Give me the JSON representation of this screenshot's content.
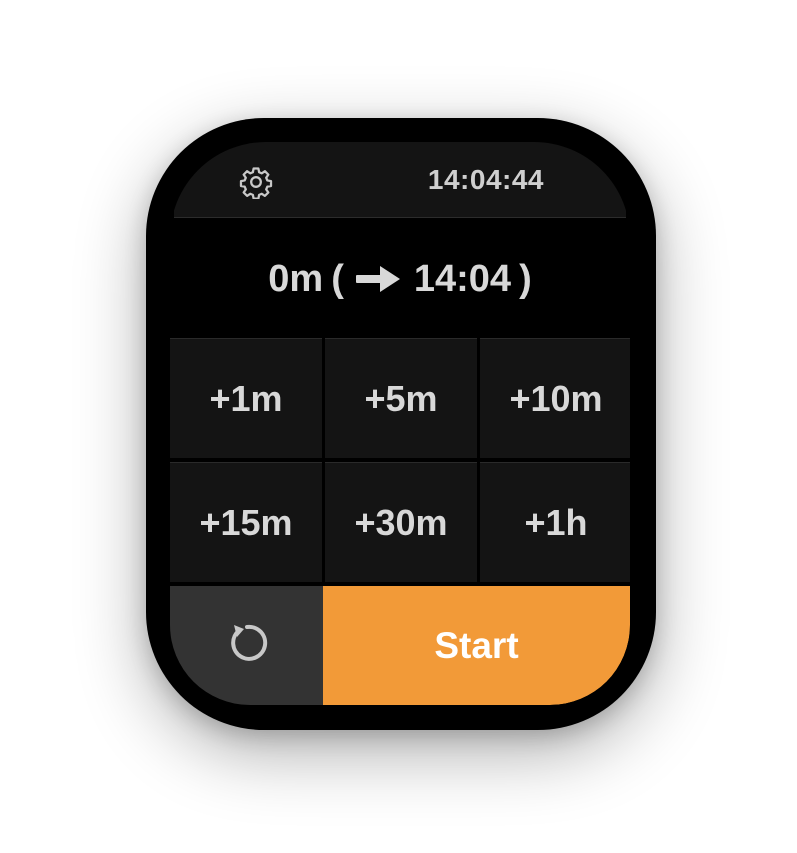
{
  "status_bar": {
    "time": "14:04:44",
    "settings_icon": "gear-icon"
  },
  "summary": {
    "duration": "0m",
    "open_paren": "(",
    "end_time": "14:04",
    "close_paren": ")",
    "arrow_icon": "arrow-right-icon"
  },
  "increments": [
    {
      "label": "+1m"
    },
    {
      "label": "+5m"
    },
    {
      "label": "+10m"
    },
    {
      "label": "+15m"
    },
    {
      "label": "+30m"
    },
    {
      "label": "+1h"
    }
  ],
  "actions": {
    "reset_icon": "reset-icon",
    "start_label": "Start"
  },
  "colors": {
    "accent": "#f29a38",
    "button_bg": "#141414",
    "reset_bg": "#333333",
    "text": "#d8d8d8"
  }
}
